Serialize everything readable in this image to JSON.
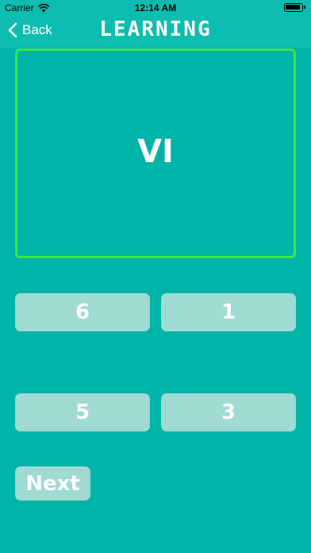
{
  "status_bar": {
    "carrier": "Carrier",
    "time": "12:14 AM",
    "icons": [
      "wifi-icon",
      "battery-icon"
    ]
  },
  "nav": {
    "back_label": "Back",
    "back_icon": "chevron-left-icon",
    "title": "LEARNING"
  },
  "question": {
    "text": "VI"
  },
  "answers": [
    {
      "label": "6"
    },
    {
      "label": "1"
    },
    {
      "label": "5"
    },
    {
      "label": "3"
    }
  ],
  "next_label": "Next",
  "colors": {
    "background": "#00b4a7",
    "card_border": "#36e84e",
    "button": "#9fdad3",
    "text": "#ffffff"
  }
}
